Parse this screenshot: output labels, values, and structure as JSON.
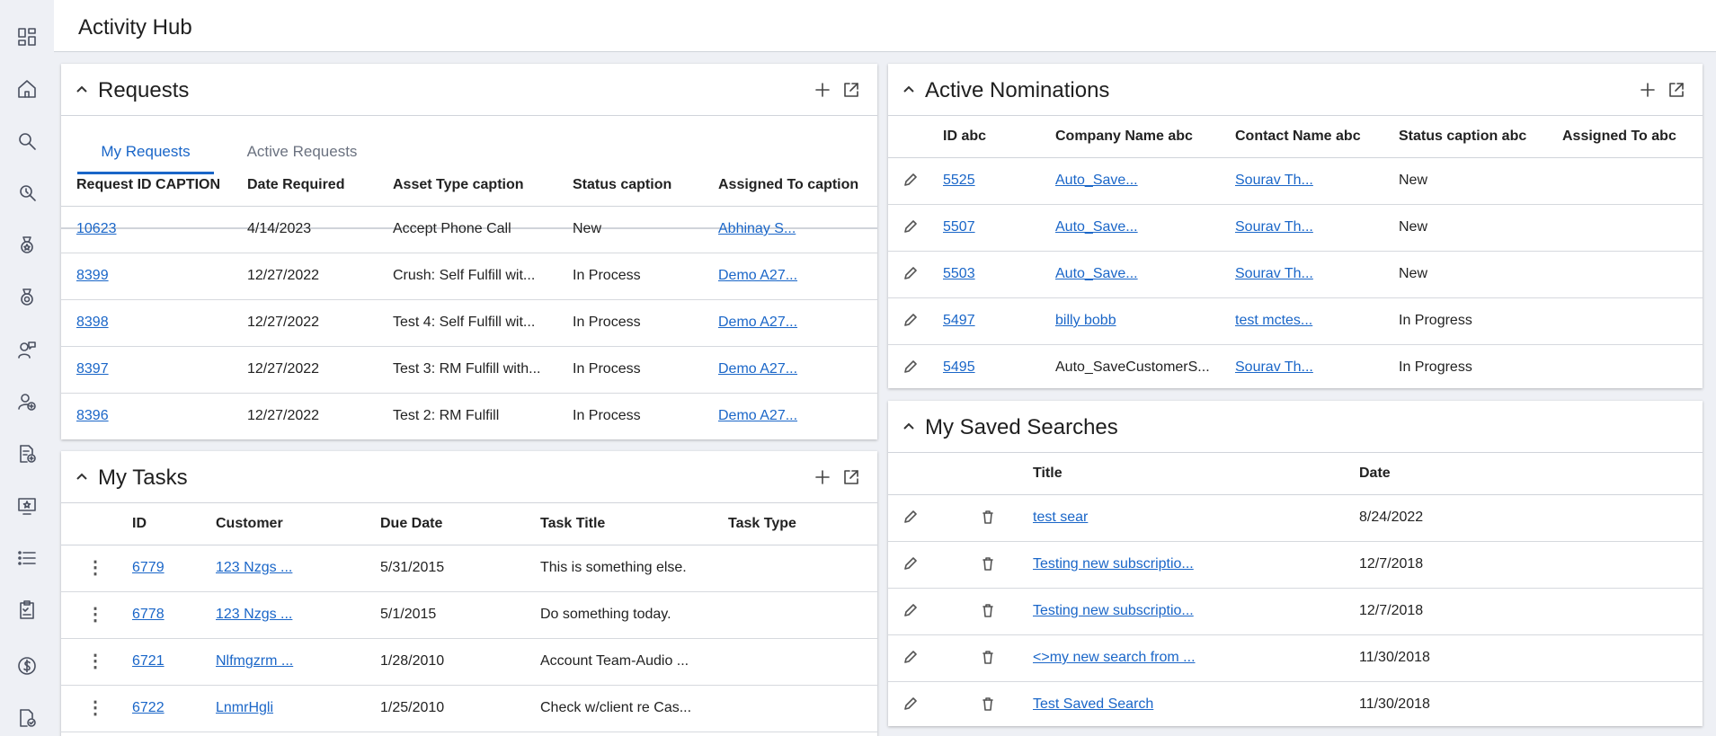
{
  "app": {
    "title": "Activity Hub"
  },
  "sidebar": {
    "items": [
      {
        "icon": "dashboard-icon"
      },
      {
        "icon": "home-icon"
      },
      {
        "icon": "search-icon"
      },
      {
        "icon": "search-map-icon"
      },
      {
        "icon": "award-icon"
      },
      {
        "icon": "award-alt-icon"
      },
      {
        "icon": "person-chat-icon"
      },
      {
        "icon": "person-add-icon"
      },
      {
        "icon": "document-add-icon"
      },
      {
        "icon": "monitor-star-icon"
      },
      {
        "icon": "list-icon"
      },
      {
        "icon": "clipboard-check-icon"
      },
      {
        "icon": "dollar-icon"
      },
      {
        "icon": "document-check-icon"
      }
    ]
  },
  "requests": {
    "title": "Requests",
    "tabs": [
      {
        "label": "My Requests",
        "active": true
      },
      {
        "label": "Active Requests",
        "active": false
      }
    ],
    "columns": [
      "Request ID CAPTION",
      "Date Required",
      "Asset Type caption",
      "Status caption",
      "Assigned To caption"
    ],
    "rows": [
      {
        "id": "10623",
        "date": "4/14/2023",
        "asset": "Accept Phone Call",
        "status": "New",
        "assigned": "Abhinay S..."
      },
      {
        "id": "8399",
        "date": "12/27/2022",
        "asset": "Crush: Self Fulfill wit...",
        "status": "In Process",
        "assigned": "Demo A27..."
      },
      {
        "id": "8398",
        "date": "12/27/2022",
        "asset": "Test 4: Self Fulfill wit...",
        "status": "In Process",
        "assigned": "Demo A27..."
      },
      {
        "id": "8397",
        "date": "12/27/2022",
        "asset": "Test 3: RM Fulfill with...",
        "status": "In Process",
        "assigned": "Demo A27..."
      },
      {
        "id": "8396",
        "date": "12/27/2022",
        "asset": "Test 2: RM Fulfill",
        "status": "In Process",
        "assigned": "Demo A27..."
      }
    ]
  },
  "tasks": {
    "title": "My Tasks",
    "columns": [
      "",
      "ID",
      "Customer",
      "Due Date",
      "Task Title",
      "Task Type"
    ],
    "rows": [
      {
        "id": "6779",
        "customer": "123 Nzgs ...",
        "due": "5/31/2015",
        "title": "This is something else.",
        "type": ""
      },
      {
        "id": "6778",
        "customer": "123 Nzgs ...",
        "due": "5/1/2015",
        "title": "Do something today.",
        "type": ""
      },
      {
        "id": "6721",
        "customer": "Nlfmgzrm ...",
        "due": "1/28/2010",
        "title": "Account Team-Audio ...",
        "type": ""
      },
      {
        "id": "6722",
        "customer": "LnmrHgli",
        "due": "1/25/2010",
        "title": "Check w/client re Cas...",
        "type": ""
      }
    ]
  },
  "nominations": {
    "title": "Active Nominations",
    "columns": [
      "",
      "ID abc",
      "Company Name abc",
      "Contact Name abc",
      "Status caption abc",
      "Assigned To abc"
    ],
    "rows": [
      {
        "id": "5525",
        "company": "Auto_Save...",
        "company_link": true,
        "contact": "Sourav Th...",
        "status": "New",
        "assigned": ""
      },
      {
        "id": "5507",
        "company": "Auto_Save...",
        "company_link": true,
        "contact": "Sourav Th...",
        "status": "New",
        "assigned": ""
      },
      {
        "id": "5503",
        "company": "Auto_Save...",
        "company_link": true,
        "contact": "Sourav Th...",
        "status": "New",
        "assigned": ""
      },
      {
        "id": "5497",
        "company": "billy bobb",
        "company_link": true,
        "contact": "test mctes...",
        "status": "In Progress",
        "assigned": ""
      },
      {
        "id": "5495",
        "company": "Auto_SaveCustomerS...",
        "company_link": false,
        "contact": "Sourav Th...",
        "status": "In Progress",
        "assigned": ""
      }
    ]
  },
  "searches": {
    "title": "My Saved Searches",
    "columns": [
      "",
      "",
      "Title",
      "Date"
    ],
    "rows": [
      {
        "title": "test sear",
        "date": "8/24/2022"
      },
      {
        "title": "Testing new subscriptio...",
        "date": "12/7/2018"
      },
      {
        "title": "Testing new subscriptio...",
        "date": "12/7/2018"
      },
      {
        "title": "<>my new search from ...",
        "date": "11/30/2018"
      },
      {
        "title": "Test Saved Search",
        "date": "11/30/2018"
      }
    ]
  }
}
